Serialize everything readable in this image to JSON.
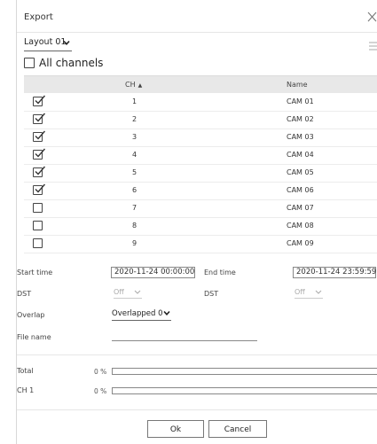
{
  "dialog": {
    "title": "Export"
  },
  "layout": {
    "selected": "Layout 01"
  },
  "all_channels": {
    "label": "All channels",
    "checked": false
  },
  "table": {
    "columns": {
      "ch": "CH",
      "name": "Name"
    },
    "rows": [
      {
        "ch": "1",
        "name": "CAM 01",
        "checked": true
      },
      {
        "ch": "2",
        "name": "CAM 02",
        "checked": true
      },
      {
        "ch": "3",
        "name": "CAM 03",
        "checked": true
      },
      {
        "ch": "4",
        "name": "CAM 04",
        "checked": true
      },
      {
        "ch": "5",
        "name": "CAM 05",
        "checked": true
      },
      {
        "ch": "6",
        "name": "CAM 06",
        "checked": true
      },
      {
        "ch": "7",
        "name": "CAM 07",
        "checked": false
      },
      {
        "ch": "8",
        "name": "CAM 08",
        "checked": false
      },
      {
        "ch": "9",
        "name": "CAM 09",
        "checked": false
      },
      {
        "ch": "",
        "name": "",
        "checked": false
      }
    ]
  },
  "form": {
    "start_time_label": "Start time",
    "start_time_value": "2020-11-24 00:00:00",
    "end_time_label": "End time",
    "end_time_value": "2020-11-24 23:59:59",
    "dst_label_1": "DST",
    "dst_value_1": "Off",
    "dst_label_2": "DST",
    "dst_value_2": "Off",
    "overlap_label": "Overlap",
    "overlap_value": "Overlapped 0",
    "file_name_label": "File name",
    "file_name_value": ""
  },
  "progress": {
    "total_label": "Total",
    "total_percent_text": "0 %",
    "total_percent": 0,
    "ch1_label": "CH 1",
    "ch1_percent_text": "0 %",
    "ch1_percent": 0
  },
  "buttons": {
    "ok": "Ok",
    "cancel": "Cancel"
  }
}
